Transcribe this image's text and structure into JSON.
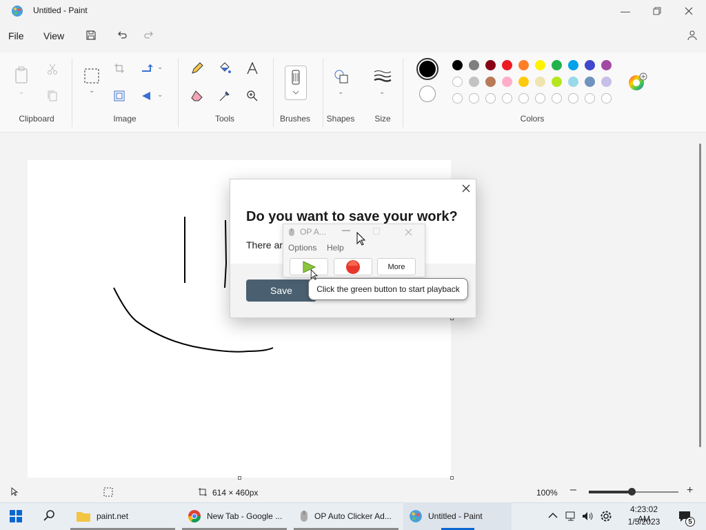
{
  "window": {
    "title": "Untitled - Paint"
  },
  "menu": {
    "file": "File",
    "view": "View"
  },
  "ribbon": {
    "groups": {
      "clipboard": "Clipboard",
      "image": "Image",
      "tools": "Tools",
      "brushes": "Brushes",
      "shapes": "Shapes",
      "size": "Size",
      "colors": "Colors"
    },
    "palette_row1": [
      "#000000",
      "#7f7f7f",
      "#880015",
      "#ed1c24",
      "#ff7f27",
      "#fff200",
      "#22b14c",
      "#00a2e8",
      "#3f48cc",
      "#a349a4"
    ],
    "palette_row2": [
      "#ffffff",
      "#c3c3c3",
      "#b97a57",
      "#ffaec9",
      "#ffc90e",
      "#efe4b0",
      "#b5e61d",
      "#99d9ea",
      "#7092be",
      "#c8bfe7"
    ],
    "primary_color": "#000000",
    "secondary_color": "#ffffff"
  },
  "dialog": {
    "title": "Do you want to save your work?",
    "message": "There are",
    "save_label": "Save"
  },
  "autoclicker": {
    "title": "OP A...",
    "menu_options": "Options",
    "menu_help": "Help",
    "more_label": "More",
    "tooltip": "Click the green button to start playback"
  },
  "status": {
    "canvas_size": "614 × 460px",
    "zoom": "100%",
    "zoom_level": 0.48
  },
  "taskbar": {
    "items": [
      "paint.net",
      "New Tab - Google ...",
      "OP Auto Clicker Ad...",
      "Untitled - Paint"
    ],
    "time": "4:23:02 AM",
    "date": "1/5/2023",
    "notifications": "5"
  }
}
